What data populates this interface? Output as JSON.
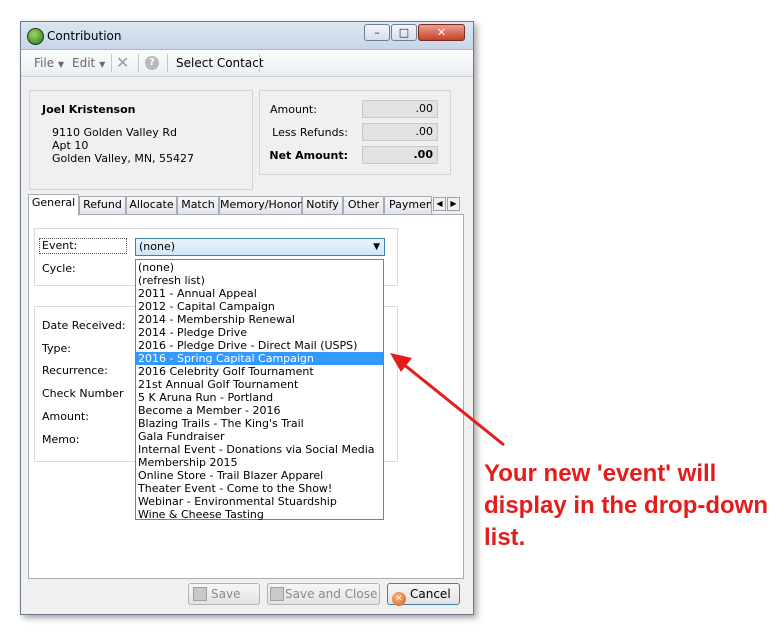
{
  "window": {
    "title": "Contribution"
  },
  "toolbar": {
    "file": "File",
    "edit": "Edit",
    "select_contact": "Select Contact"
  },
  "contact": {
    "name": "Joel Kristenson",
    "address1": "9110 Golden Valley Rd",
    "address2": "Apt 10",
    "address3": "Golden Valley, MN, 55427"
  },
  "amounts": {
    "amount_label": "Amount:",
    "amount_value": ".00",
    "refunds_label": "Less Refunds:",
    "refunds_value": ".00",
    "net_label": "Net Amount:",
    "net_value": ".00"
  },
  "tabs": [
    "General",
    "Refund",
    "Allocate",
    "Match",
    "Memory/Honor",
    "Notify",
    "Other",
    "Payment"
  ],
  "form": {
    "event_label": "Event:",
    "event_value": "(none)",
    "cycle_label": "Cycle:",
    "date_label": "Date Received:",
    "type_label": "Type:",
    "recurrence_label": "Recurrence:",
    "check_label": "Check Number",
    "amount_label": "Amount:",
    "memo_label": "Memo:"
  },
  "event_options": [
    "(none)",
    "(refresh list)",
    "2011 - Annual Appeal",
    "2012 - Capital Campaign",
    "2014 - Membership Renewal",
    "2014 - Pledge Drive",
    "2016 - Pledge Drive - Direct Mail (USPS)",
    "2016 - Spring Capital Campaign",
    "2016 Celebrity Golf Tournament",
    "21st Annual Golf Tournament",
    "5 K Aruna Run - Portland",
    "Become a Member - 2016",
    "Blazing Trails - The King's Trail",
    "Gala Fundraiser",
    "Internal Event - Donations via Social Media",
    "Membership 2015",
    "Online Store - Trail Blazer Apparel",
    "Theater Event - Come to the Show!",
    "Webinar - Environmental Stuardship",
    "Wine & Cheese Tasting"
  ],
  "selected_option_index": 7,
  "buttons": {
    "save": "Save",
    "save_close": "Save and Close",
    "cancel": "Cancel"
  },
  "annotation": {
    "text": "Your new 'event' will display in the drop-down list."
  },
  "colors": {
    "annotation": "#e31c1c",
    "selection": "#3399ff"
  }
}
